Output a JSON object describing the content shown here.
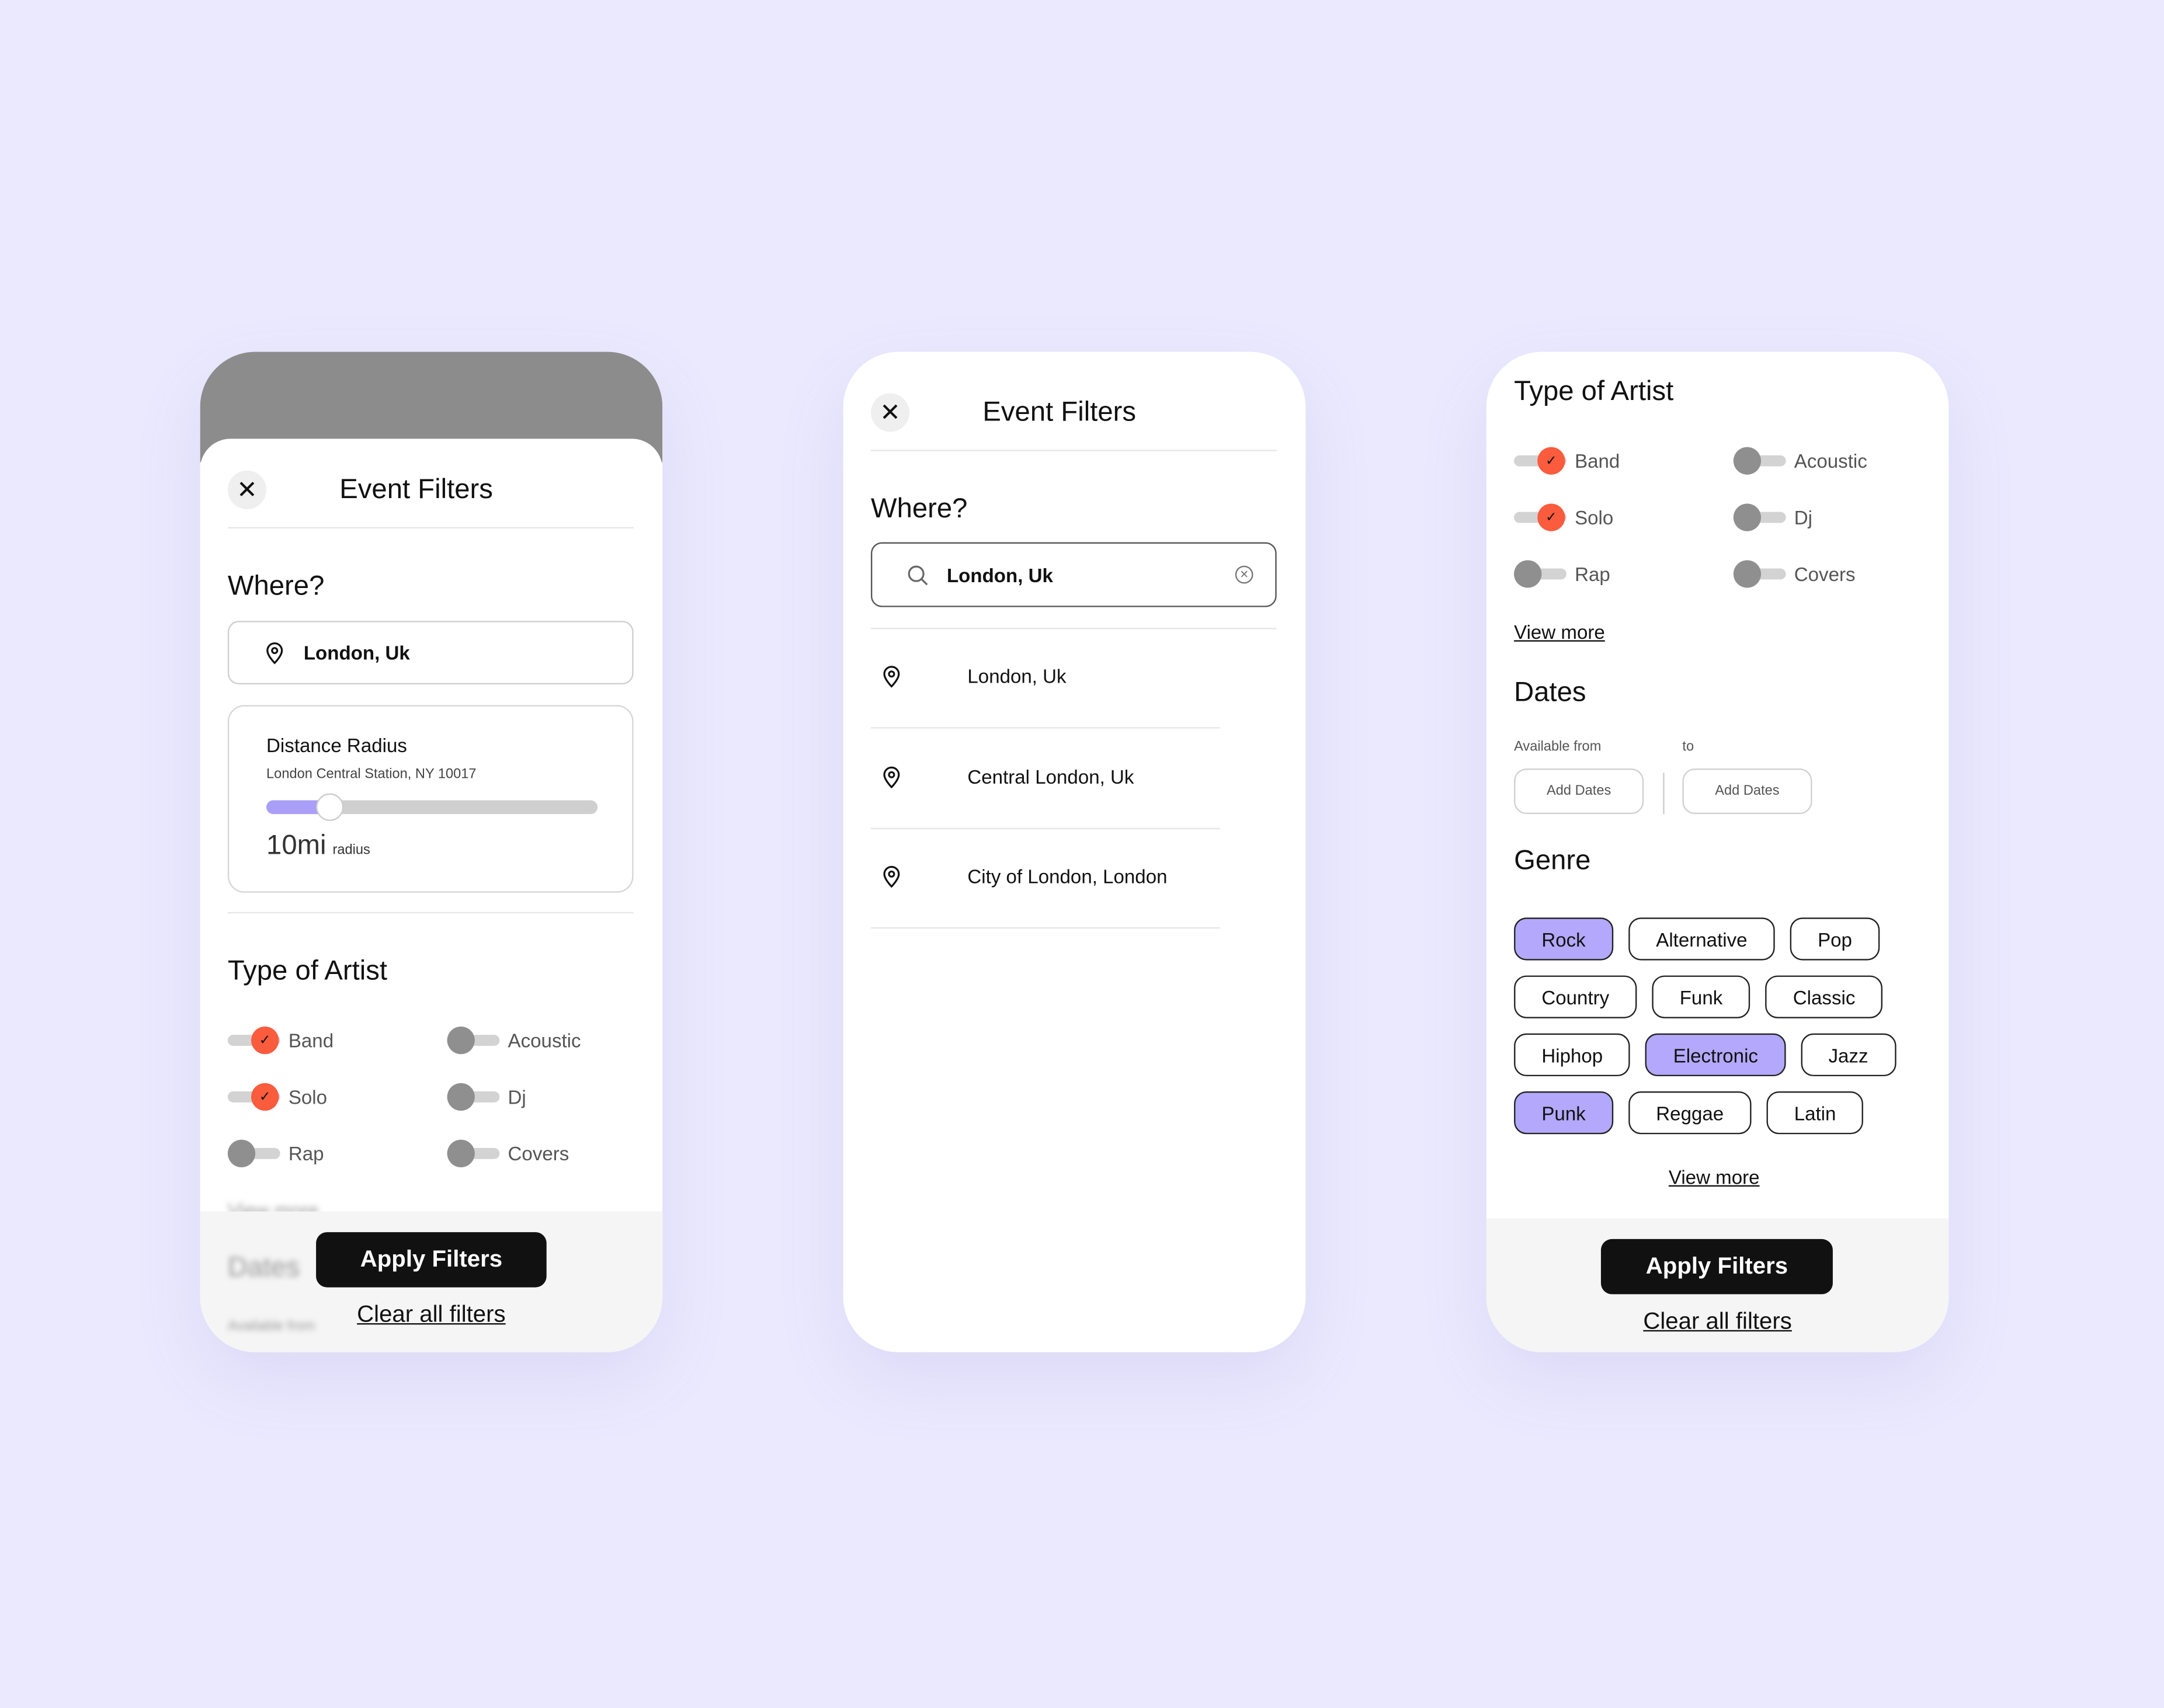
{
  "colors": {
    "background": "#ebe9fe",
    "accent_purple": "#b3a8fb",
    "toggle_on": "#fa5c3d",
    "toggle_off": "#8f8f8f",
    "button": "#111111"
  },
  "screen1": {
    "title": "Event Filters",
    "close_icon": "close-icon",
    "where_heading": "Where?",
    "location_value": "London, Uk",
    "distance": {
      "label": "Distance Radius",
      "subtitle": "London Central Station, NY 10017",
      "value": "10mi",
      "unit": "radius",
      "slider_fraction": 0.15
    },
    "artist_heading": "Type of Artist",
    "artist_types": [
      {
        "label": "Band",
        "on": true
      },
      {
        "label": "Acoustic",
        "on": false
      },
      {
        "label": "Solo",
        "on": true
      },
      {
        "label": "Dj",
        "on": false
      },
      {
        "label": "Rap",
        "on": false
      },
      {
        "label": "Covers",
        "on": false
      }
    ],
    "view_more": "View more",
    "dates_heading": "Dates",
    "available_from": "Available from",
    "apply": "Apply Filters",
    "clear": "Clear all filters"
  },
  "screen2": {
    "title": "Event Filters",
    "where_heading": "Where?",
    "search_value": "London, Uk",
    "results": [
      "London, Uk",
      "Central London, Uk",
      "City of London, London"
    ]
  },
  "screen3": {
    "artist_heading": "Type of Artist",
    "artist_types": [
      {
        "label": "Band",
        "on": true
      },
      {
        "label": "Acoustic",
        "on": false
      },
      {
        "label": "Solo",
        "on": true
      },
      {
        "label": "Dj",
        "on": false
      },
      {
        "label": "Rap",
        "on": false
      },
      {
        "label": "Covers",
        "on": false
      }
    ],
    "view_more": "View more",
    "dates_heading": "Dates",
    "available_from": "Available from",
    "to": "to",
    "add_dates": "Add Dates",
    "genre_heading": "Genre",
    "genres": [
      {
        "label": "Rock",
        "selected": true
      },
      {
        "label": "Alternative",
        "selected": false
      },
      {
        "label": "Pop",
        "selected": false
      },
      {
        "label": "Country",
        "selected": false
      },
      {
        "label": "Funk",
        "selected": false
      },
      {
        "label": "Classic",
        "selected": false
      },
      {
        "label": "Hiphop",
        "selected": false
      },
      {
        "label": "Electronic",
        "selected": true
      },
      {
        "label": "Jazz",
        "selected": false
      },
      {
        "label": "Punk",
        "selected": true
      },
      {
        "label": "Reggae",
        "selected": false
      },
      {
        "label": "Latin",
        "selected": false
      }
    ],
    "genre_view_more": "View more",
    "apply": "Apply Filters",
    "clear": "Clear all filters"
  }
}
